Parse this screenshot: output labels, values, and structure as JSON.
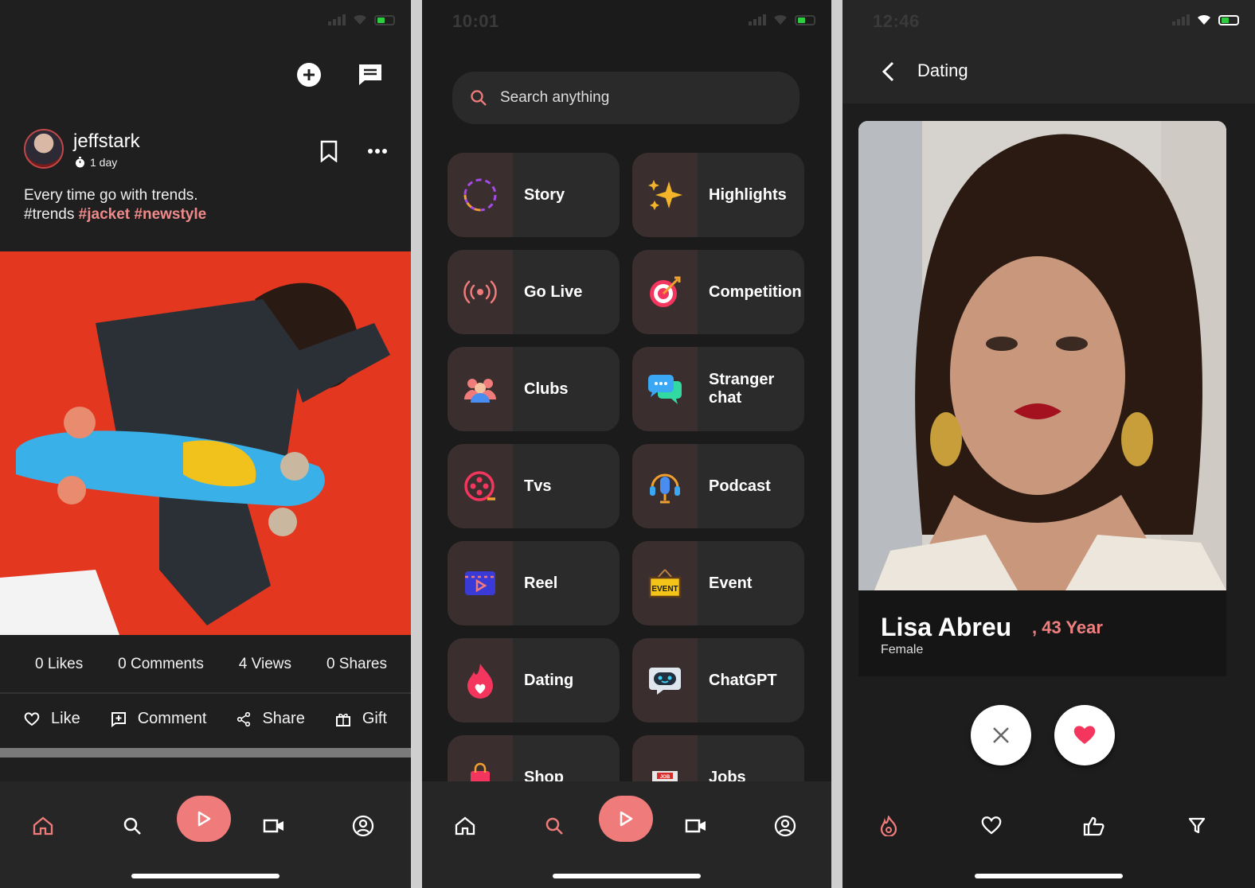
{
  "screen1": {
    "username": "jeffstark",
    "time_ago": "1 day",
    "caption_line1": "Every time go with trends.",
    "caption_tag_plain": "#trends",
    "caption_tag_hi1": "#jacket",
    "caption_tag_hi2": "#newstyle",
    "stats": {
      "likes": "0 Likes",
      "comments": "0 Comments",
      "views": "4 Views",
      "shares": "0 Shares"
    },
    "actions": {
      "like": "Like",
      "comment": "Comment",
      "share": "Share",
      "gift": "Gift"
    }
  },
  "screen2": {
    "time": "10:01",
    "search_placeholder": "Search anything",
    "tiles": [
      {
        "label": "Story",
        "icon": "story-ring-icon"
      },
      {
        "label": "Highlights",
        "icon": "sparkles-icon"
      },
      {
        "label": "Go Live",
        "icon": "broadcast-icon"
      },
      {
        "label": "Competition",
        "icon": "target-icon"
      },
      {
        "label": "Clubs",
        "icon": "group-icon"
      },
      {
        "label": "Stranger chat",
        "icon": "chat-bubbles-icon"
      },
      {
        "label": "Tvs",
        "icon": "film-reel-icon"
      },
      {
        "label": "Podcast",
        "icon": "podcast-mic-icon"
      },
      {
        "label": "Reel",
        "icon": "clapper-icon"
      },
      {
        "label": "Event",
        "icon": "event-sign-icon"
      },
      {
        "label": "Dating",
        "icon": "flame-heart-icon"
      },
      {
        "label": "ChatGPT",
        "icon": "robot-icon"
      },
      {
        "label": "Shop",
        "icon": "shopping-bag-icon"
      },
      {
        "label": "Jobs",
        "icon": "job-board-icon"
      }
    ]
  },
  "screen3": {
    "time": "12:46",
    "title": "Dating",
    "name": "Lisa Abreu",
    "age": ", 43 Year",
    "gender": "Female"
  },
  "colors": {
    "accent": "#f07b7b",
    "background": "#1f1f1f",
    "tile": "#2b2b2b"
  }
}
